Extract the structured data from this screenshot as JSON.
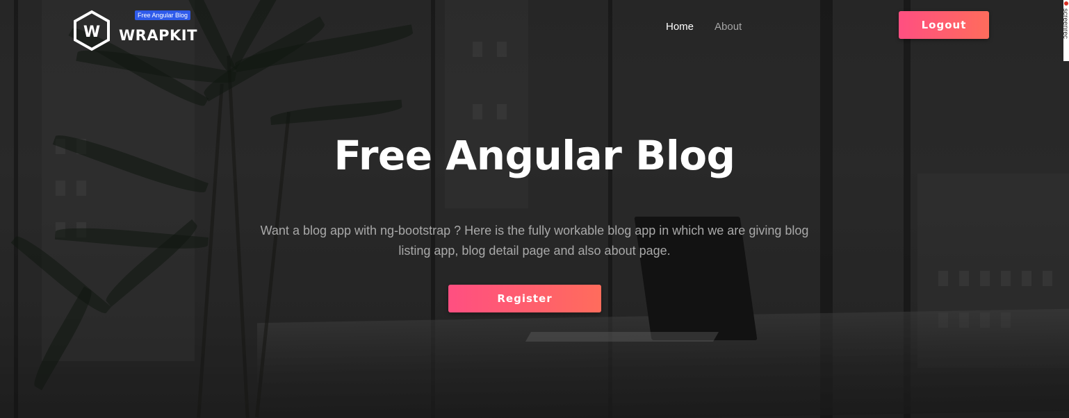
{
  "header": {
    "logo_letter": "W",
    "logo_name": "WRAPKIT",
    "logo_badge": "Free Angular Blog",
    "logo_icon": "hexagon-w-logo-icon"
  },
  "nav": {
    "items": [
      {
        "label": "Home",
        "active": true
      },
      {
        "label": "About",
        "active": false
      }
    ]
  },
  "auth": {
    "logout_label": "Logout"
  },
  "side_tab": {
    "label": "screenrec"
  },
  "hero": {
    "title": "Free Angular Blog",
    "subtitle": "Want a blog app with ng-bootstrap ? Here is the fully workable blog app in which we are giving blog listing app, blog detail page and also about page.",
    "cta_label": "Register"
  },
  "colors": {
    "accent_start": "#ff4f81",
    "accent_end": "#ff6c5c",
    "badge": "#2f5bea",
    "nav_active": "#ffffff",
    "nav_inactive": "#a6a6a6"
  }
}
